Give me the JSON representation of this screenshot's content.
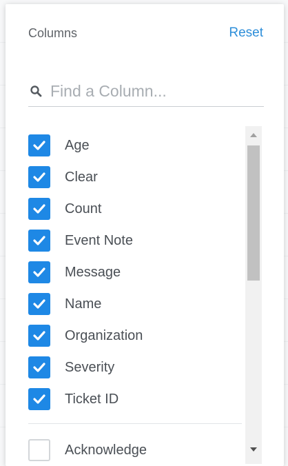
{
  "panel": {
    "title": "Columns",
    "reset_label": "Reset"
  },
  "search": {
    "placeholder": "Find a Column...",
    "value": ""
  },
  "columns": [
    {
      "label": "Age",
      "checked": true
    },
    {
      "label": "Clear",
      "checked": true
    },
    {
      "label": "Count",
      "checked": true
    },
    {
      "label": "Event Note",
      "checked": true
    },
    {
      "label": "Message",
      "checked": true
    },
    {
      "label": "Name",
      "checked": true
    },
    {
      "label": "Organization",
      "checked": true
    },
    {
      "label": "Severity",
      "checked": true
    },
    {
      "label": "Ticket ID",
      "checked": true
    }
  ],
  "hidden_columns": [
    {
      "label": "Acknowledge",
      "checked": false
    }
  ],
  "colors": {
    "accent": "#1e88e5",
    "reset_link": "#2d8ed9"
  }
}
